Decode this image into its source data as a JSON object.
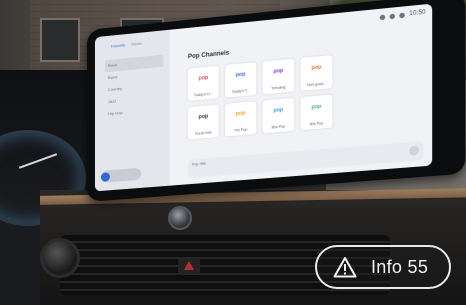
{
  "screen": {
    "status_time": "10:50",
    "sidebar": {
      "tabs": [
        "Favorite",
        "Music"
      ],
      "items": [
        "Rock",
        "Band",
        "Country",
        "Jazz",
        "Hip-Hop"
      ]
    },
    "main": {
      "title": "Pop Channels",
      "tiles": [
        {
          "logo": "pop",
          "label": "Today's H..."
        },
        {
          "logo": "pop",
          "label": "Today's T..."
        },
        {
          "logo": "pop",
          "label": "Trending"
        },
        {
          "logo": "pop",
          "label": "Feel good..."
        },
        {
          "logo": "pop",
          "label": "Fresh Hits"
        },
        {
          "logo": "pop",
          "label": "70s Pop"
        },
        {
          "logo": "pop",
          "label": "80s Pop"
        },
        {
          "logo": "pop",
          "label": "90s Pop"
        }
      ],
      "now_playing": "Pop Hits"
    }
  },
  "badge": {
    "text": "Info 55",
    "icon": "warning-triangle-icon"
  }
}
